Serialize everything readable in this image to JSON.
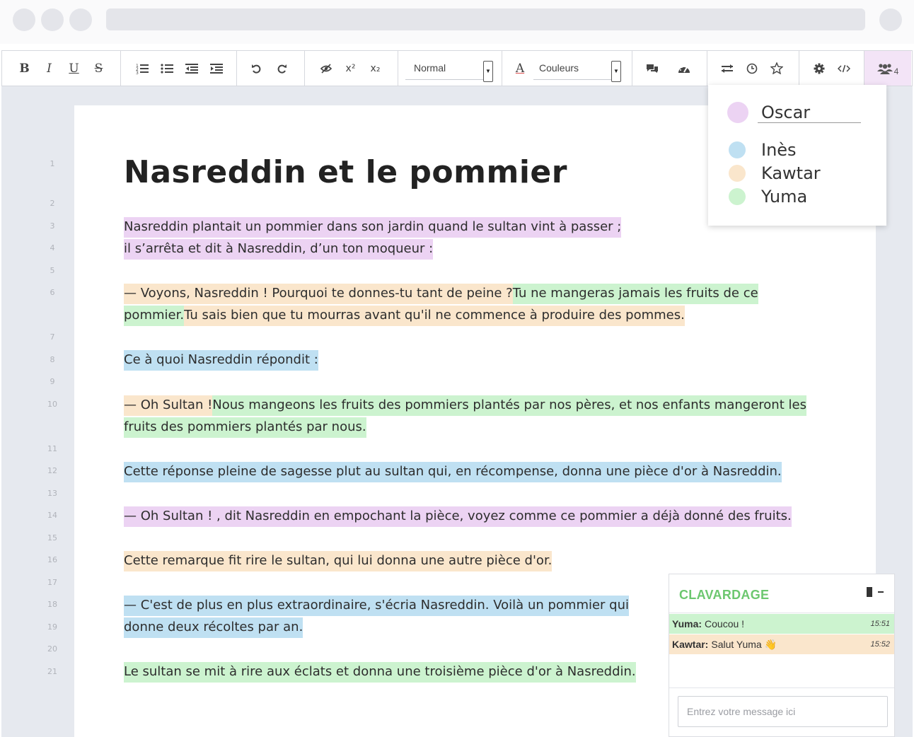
{
  "toolbar": {
    "bold": "B",
    "italic": "I",
    "underline": "U",
    "strike": "S",
    "superscript": "x²",
    "subscript": "x₂",
    "format_select": "Normal",
    "color_letter": "A",
    "color_select": "Couleurs",
    "users_count": "4"
  },
  "users": [
    {
      "name": "Oscar",
      "color": "#ecd3f3"
    },
    {
      "name": "Inès",
      "color": "#bfe0f2"
    },
    {
      "name": "Kawtar",
      "color": "#fae6cc"
    },
    {
      "name": "Yuma",
      "color": "#ccf3cf"
    }
  ],
  "document": {
    "title": "Nasreddin et le pommier",
    "line_numbers": [
      "1",
      "2",
      "3",
      "4",
      "5",
      "6",
      "7",
      "8",
      "9",
      "10",
      "11",
      "12",
      "13",
      "14",
      "15",
      "16",
      "17",
      "18",
      "19",
      "20",
      "21"
    ],
    "p1a": "Nasreddin plantait un pommier dans son jardin quand le sultan vint à passer ;",
    "p1b": "il s’arrêta et dit à Nasreddin, d’un ton moqueur :",
    "p2_kawtar": "— Voyons, Nasreddin ! Pourquoi te donnes-tu tant de peine ?",
    "p2_yuma": "Tu ne mangeras jamais les fruits de ce pommier.",
    "p2_kawtar2": "Tu sais bien que tu mourras avant qu'il ne commence à produire des pommes.",
    "p3": "Ce à quoi Nasreddin répondit :",
    "p4_kawtar": "— Oh Sultan !",
    "p4_yuma": "Nous mangeons les fruits des pommiers plantés par nos pères, et nos enfants mangeront les fruits des pommiers plantés par nous.",
    "p5": "Cette réponse pleine de sagesse plut au sultan qui, en récompense, donna une pièce d'or à Nasreddin.",
    "p6": "— Oh Sultan ! , dit Nasreddin en empochant la pièce, voyez comme ce pommier a déjà donné des fruits.",
    "p7": "Cette remarque fit rire le sultan, qui lui donna une autre pièce d'or.",
    "p8": "— C'est de plus en plus extraordinaire, s'écria Nasreddin. Voilà un pommier qui donne deux récoltes par an.",
    "p9": "Le sultan se mit à rire aux éclats et donna une troisième pièce d'or à Nasreddin."
  },
  "chat": {
    "title": "CLAVARDAGE",
    "messages": [
      {
        "author": "Yuma:",
        "text": "Coucou !",
        "time": "15:51",
        "color": "#ccf3cf"
      },
      {
        "author": "Kawtar:",
        "text": "Salut Yuma 👋",
        "time": "15:52",
        "color": "#fae6cc"
      }
    ],
    "input_placeholder": "Entrez votre message ici"
  },
  "colors": {
    "oscar": "#ecd3f3",
    "ines": "#bfe0f2",
    "kawtar": "#fae6cc",
    "yuma": "#ccf3cf",
    "chat_title": "#6cc76f"
  }
}
